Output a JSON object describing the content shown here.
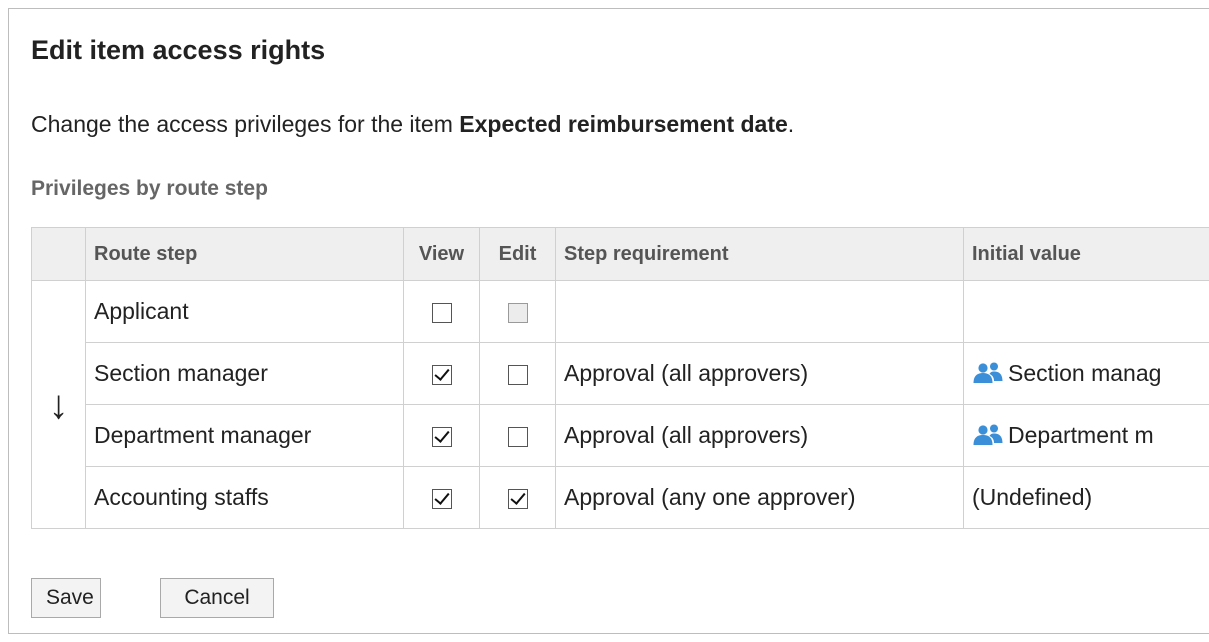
{
  "dialog": {
    "title": "Edit item access rights",
    "description_prefix": "Change the access privileges for the item ",
    "item_name": "Expected reimbursement date",
    "description_suffix": ".",
    "section_title": "Privileges by route step"
  },
  "table": {
    "headers": {
      "route_step": "Route step",
      "view": "View",
      "edit": "Edit",
      "step_requirement": "Step requirement",
      "initial_value": "Initial value"
    },
    "flow_arrow": "↓",
    "rows": [
      {
        "route_step": "Applicant",
        "view": false,
        "edit": false,
        "edit_disabled": true,
        "step_requirement": "",
        "initial_value": "",
        "initial_value_icon": ""
      },
      {
        "route_step": "Section manager",
        "view": true,
        "edit": false,
        "edit_disabled": false,
        "step_requirement": "Approval (all approvers)",
        "initial_value": "Section manag",
        "initial_value_icon": "group-icon"
      },
      {
        "route_step": "Department manager",
        "view": true,
        "edit": false,
        "edit_disabled": false,
        "step_requirement": "Approval (all approvers)",
        "initial_value": "Department m",
        "initial_value_icon": "group-icon"
      },
      {
        "route_step": "Accounting staffs",
        "view": true,
        "edit": true,
        "edit_disabled": false,
        "step_requirement": "Approval (any one approver)",
        "initial_value": "(Undefined)",
        "initial_value_icon": ""
      }
    ]
  },
  "buttons": {
    "save_label": "Save",
    "cancel_label": "Cancel"
  },
  "colors": {
    "icon_blue": "#3a8fd8",
    "header_bg": "#efefef",
    "section_title": "#666666"
  }
}
